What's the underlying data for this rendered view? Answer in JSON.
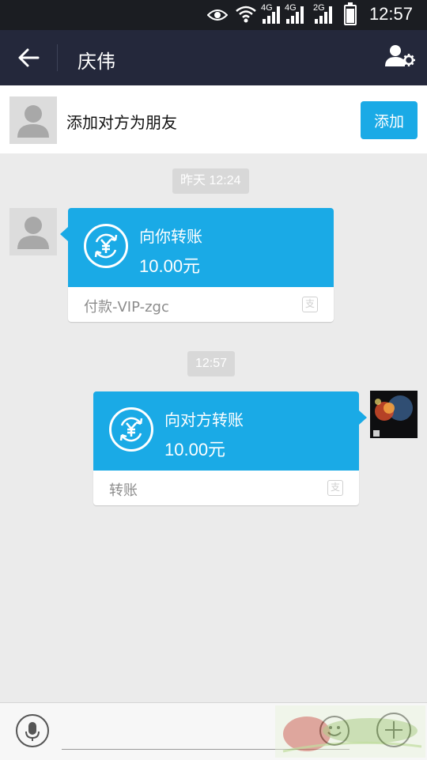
{
  "status_bar": {
    "time": "12:57",
    "net_label_1": "4G",
    "net_label_2": "4G",
    "net_label_3": "2G",
    "battery_level": 0.9
  },
  "header": {
    "title": "庆伟",
    "back_icon": "back-arrow-icon",
    "profile_icon": "contact-settings-icon"
  },
  "add_friend": {
    "text": "添加对方为朋友",
    "button_label": "添加"
  },
  "messages": [
    {
      "timestamp": "昨天 12:24",
      "direction": "incoming",
      "title": "向你转账",
      "amount": "10.00元",
      "footer": "付款-VIP-zgc",
      "footer_icon": "alipay-icon"
    },
    {
      "timestamp": "12:57",
      "direction": "outgoing",
      "title": "向对方转账",
      "amount": "10.00元",
      "footer": "转账",
      "footer_icon": "alipay-icon"
    }
  ],
  "input_bar": {
    "placeholder": "",
    "voice_icon": "microphone-icon",
    "emoji_icon": "emoji-icon",
    "plus_icon": "plus-icon"
  },
  "colors": {
    "header_bg": "#24283b",
    "accent": "#1aaae6",
    "background": "#ebebeb"
  }
}
